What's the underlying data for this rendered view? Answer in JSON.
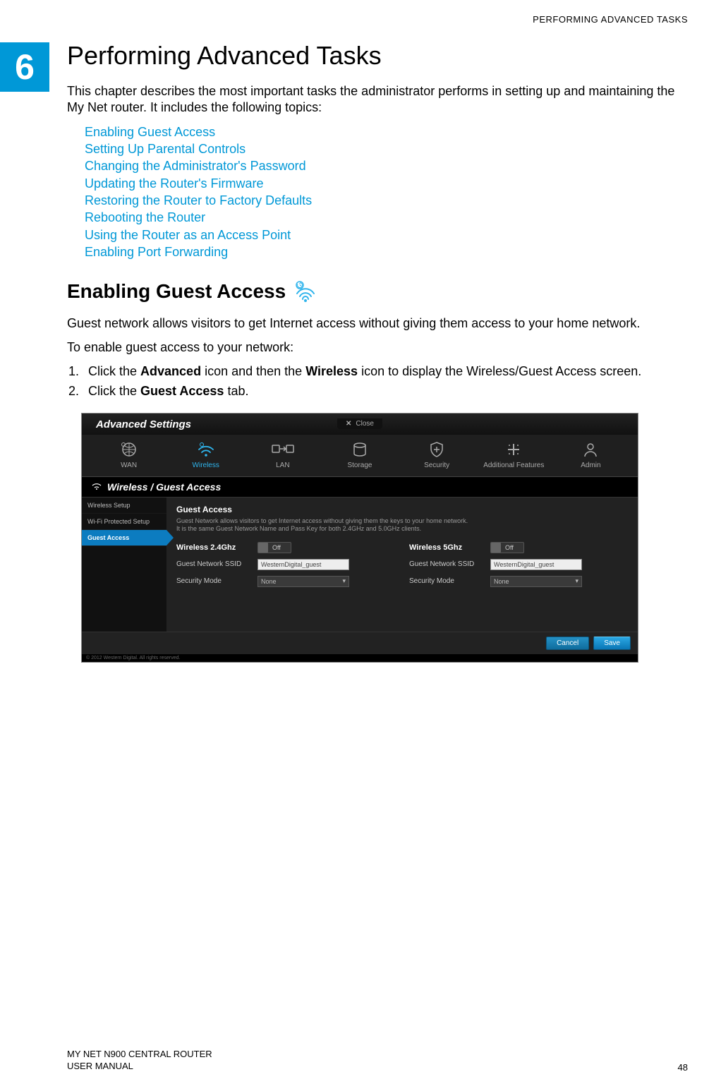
{
  "running_header": "PERFORMING ADVANCED TASKS",
  "chapter_number": "6",
  "chapter_title": "Performing Advanced Tasks",
  "intro": "This chapter describes the most important tasks the administrator performs in setting up and maintaining the My Net router. It includes the following topics:",
  "topics": [
    "Enabling Guest Access",
    "Setting Up Parental Controls",
    "Changing the Administrator's Password",
    "Updating the Router's Firmware",
    "Restoring the Router to Factory Defaults",
    "Rebooting the Router",
    "Using the Router as an Access Point",
    "Enabling Port Forwarding"
  ],
  "section_heading": "Enabling Guest Access",
  "section_body1": "Guest network allows visitors to get Internet access without giving them access to your home network.",
  "section_body2": "To enable guest access to your network:",
  "step1_pre": "Click the ",
  "step1_b1": "Advanced",
  "step1_mid": " icon and then the ",
  "step1_b2": "Wireless",
  "step1_post": " icon to display the Wireless/Guest Access screen.",
  "step2_pre": "Click the ",
  "step2_b1": "Guest Access",
  "step2_post": " tab.",
  "screenshot": {
    "title": "Advanced Settings",
    "close_label": "Close",
    "nav": [
      {
        "label": "WAN"
      },
      {
        "label": "Wireless"
      },
      {
        "label": "LAN"
      },
      {
        "label": "Storage"
      },
      {
        "label": "Security"
      },
      {
        "label": "Additional Features"
      },
      {
        "label": "Admin"
      }
    ],
    "breadcrumb_prefix": "Wireless / ",
    "breadcrumb_section": "Guest Access",
    "sidenav": [
      "Wireless Setup",
      "Wi-Fi Protected Setup",
      "Guest Access"
    ],
    "panel_title": "Guest Access",
    "panel_desc1": "Guest Network allows visitors to get Internet access without giving them the keys to your home network.",
    "panel_desc2": "It is the same Guest Network Name and Pass Key for both 2.4GHz and 5.0GHz clients.",
    "col1_head": "Wireless 2.4Ghz",
    "col2_head": "Wireless 5Ghz",
    "toggle_off": "Off",
    "row_ssid_label": "Guest Network SSID",
    "row_mode_label": "Security Mode",
    "ssid_value": "WesternDigital_guest",
    "mode_value": "None",
    "cancel": "Cancel",
    "save": "Save",
    "copyright": "© 2012 Western Digital. All rights reserved."
  },
  "footer": {
    "product": "MY NET N900 CENTRAL ROUTER",
    "doc": "USER MANUAL",
    "page": "48"
  }
}
